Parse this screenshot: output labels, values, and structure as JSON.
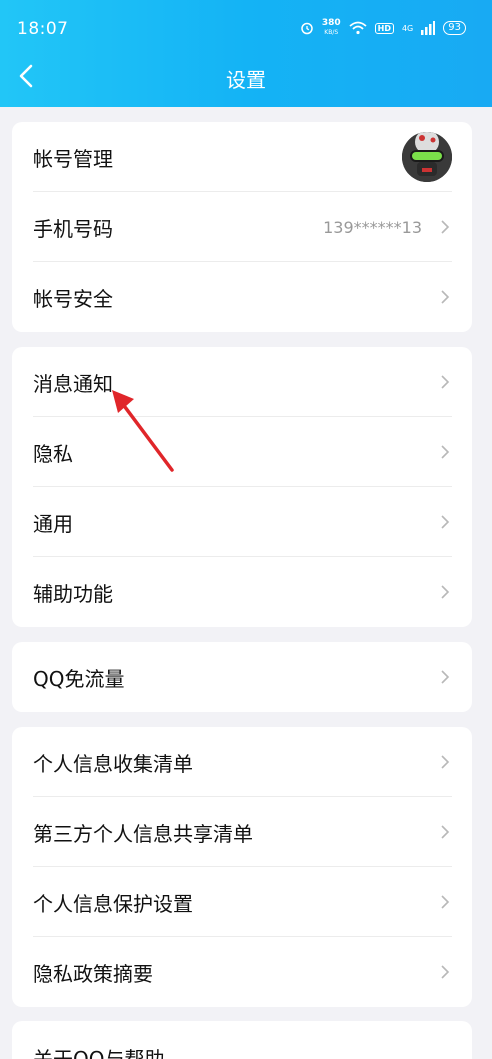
{
  "status_bar": {
    "time": "18:07",
    "speed_value": "380",
    "speed_unit": "KB/S",
    "hd": "HD",
    "battery": "93",
    "signal": "4G"
  },
  "nav": {
    "title": "设置"
  },
  "groups": [
    {
      "items": [
        {
          "label": "帐号管理"
        },
        {
          "label": "手机号码",
          "value": "139******13"
        },
        {
          "label": "帐号安全"
        }
      ]
    },
    {
      "items": [
        {
          "label": "消息通知"
        },
        {
          "label": "隐私"
        },
        {
          "label": "通用"
        },
        {
          "label": "辅助功能"
        }
      ]
    },
    {
      "items": [
        {
          "label": "QQ免流量"
        }
      ]
    },
    {
      "items": [
        {
          "label": "个人信息收集清单"
        },
        {
          "label": "第三方个人信息共享清单"
        },
        {
          "label": "个人信息保护设置"
        },
        {
          "label": "隐私政策摘要"
        }
      ]
    },
    {
      "items": [
        {
          "label": "关于QQ与帮助"
        }
      ]
    }
  ],
  "colors": {
    "header_start": "#22c6f7",
    "header_end": "#18aaf3",
    "annotation_arrow": "#e0262a"
  }
}
